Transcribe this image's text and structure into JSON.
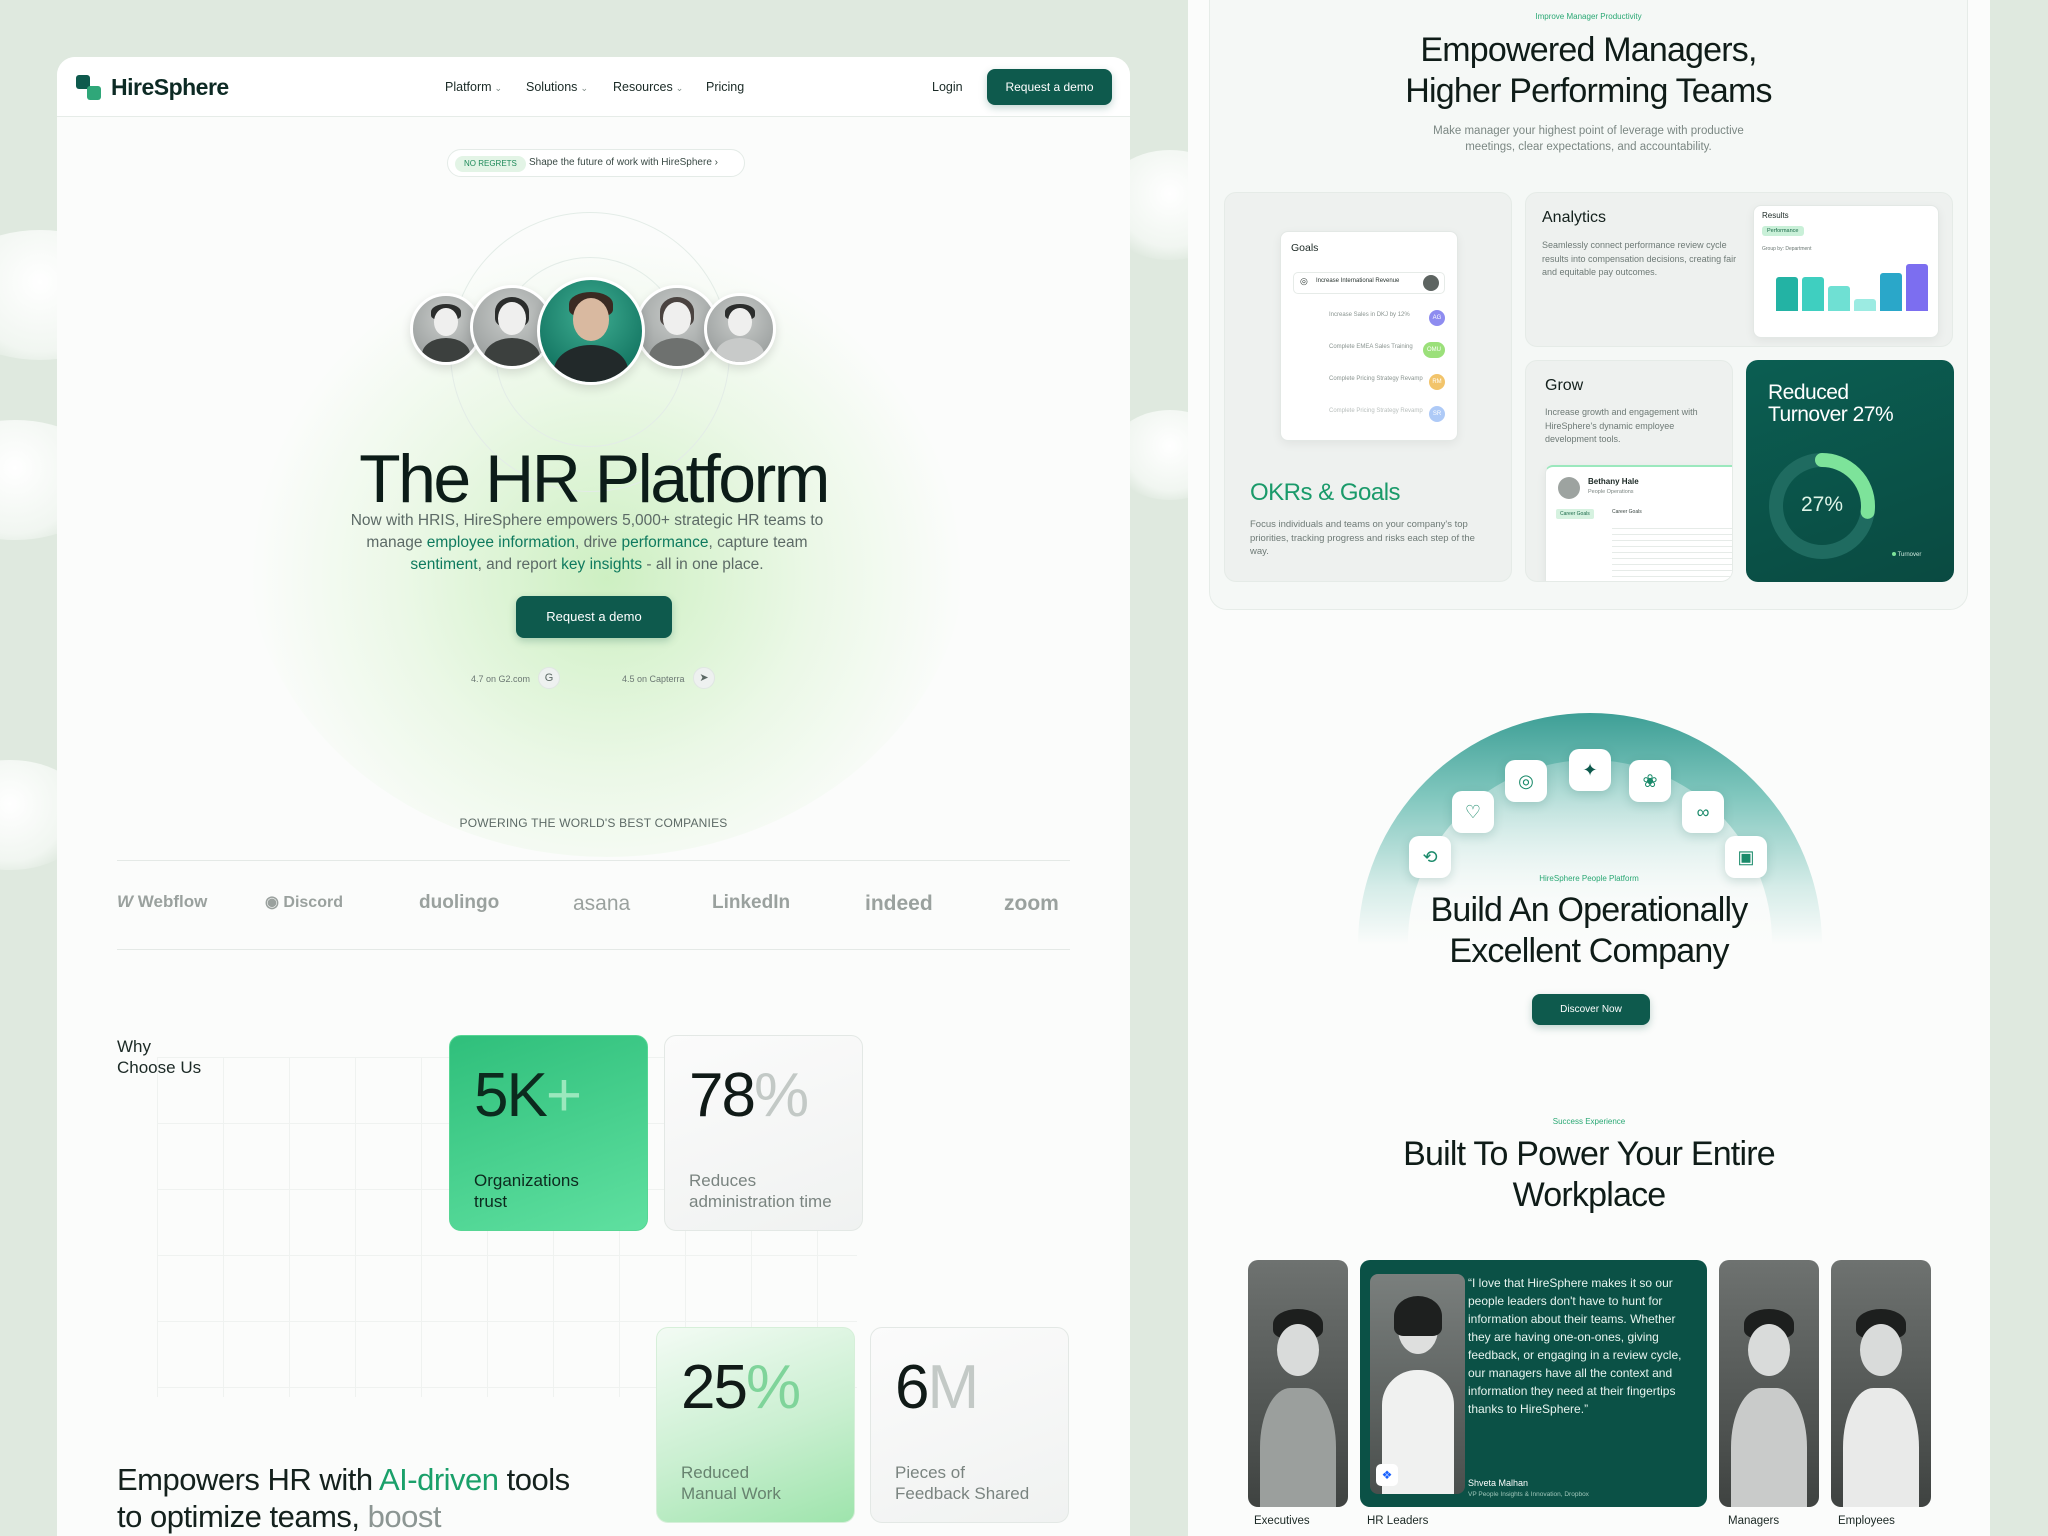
{
  "left": {
    "nav": {
      "logo": "HireSphere",
      "items": [
        {
          "label": "Platform",
          "has_dropdown": true
        },
        {
          "label": "Solutions",
          "has_dropdown": true
        },
        {
          "label": "Resources",
          "has_dropdown": true
        },
        {
          "label": "Pricing",
          "has_dropdown": false
        }
      ],
      "login": "Login",
      "cta": "Request a demo"
    },
    "banner": {
      "tag": "NO REGRETS",
      "text": "Shape the future of work with HireSphere",
      "arrow": "›"
    },
    "hero": {
      "title": "The HR Platform",
      "subtitle_parts": [
        "Now with HRIS, HireSphere empowers 5,000+ strategic HR teams to manage ",
        "employee information",
        ", drive ",
        "performance",
        ", capture team ",
        "sentiment",
        ", and report ",
        "key insights",
        " - all in one place."
      ],
      "cta": "Request a demo"
    },
    "ratings": [
      {
        "label": "4.7 on G2.com",
        "icon": "g2-icon"
      },
      {
        "label": "4.5 on Capterra",
        "icon": "capterra-icon"
      }
    ],
    "powering": "POWERING THE WORLD'S BEST COMPANIES",
    "brands": [
      "Webflow",
      "Discord",
      "duolingo",
      "asana",
      "LinkedIn",
      "indeed",
      "zoom"
    ],
    "why": {
      "line1": "Why",
      "line2": "Choose Us"
    },
    "stats": [
      {
        "main": "5K",
        "suffix": "+",
        "line1": "Organizations",
        "line2": "trust"
      },
      {
        "main": "78",
        "suffix": "%",
        "line1": "Reduces",
        "line2": "administration time"
      },
      {
        "main": "25",
        "suffix": "%",
        "line1": "Reduced",
        "line2": "Manual Work"
      },
      {
        "main": "6",
        "suffix": "M",
        "line1": "Pieces of",
        "line2": "Feedback Shared"
      }
    ],
    "empower": {
      "p1": "Empowers HR with ",
      "ai": "AI-driven",
      "p2": " tools to optimize teams, ",
      "muted": "boost productivity, and drive success"
    }
  },
  "right": {
    "managers": {
      "eyebrow": "Improve Manager Productivity",
      "title_line1": "Empowered Managers,",
      "title_line2": "Higher Performing Teams",
      "sub_line1": "Make manager your highest point of leverage with productive",
      "sub_line2": "meetings, clear expectations, and accountability."
    },
    "okr": {
      "goals_label": "Goals",
      "goals": [
        {
          "text": "Increase International Revenue",
          "badge": ""
        },
        {
          "text": "Increase Sales in DKJ by 12%",
          "badge": "AG"
        },
        {
          "text": "Complete EMEA Sales Training",
          "badge": "OMU"
        },
        {
          "text": "Complete Pricing Strategy Revamp",
          "badge": "RM"
        },
        {
          "text": "Complete Pricing Strategy Revamp",
          "badge": "SR"
        }
      ],
      "title": "OKRs & Goals",
      "desc": "Focus individuals and teams on your company's top priorities, tracking progress and risks each step of the way."
    },
    "analytics": {
      "title": "Analytics",
      "desc": "Seamlessly connect performance review cycle results into compensation decisions, creating fair and equitable pay outcomes.",
      "results_label": "Results",
      "results_pill": "Performance",
      "results_filter": "Group by: Department",
      "bars": [
        0.55,
        0.55,
        0.4,
        0.2,
        0.62,
        0.75
      ]
    },
    "grow": {
      "title": "Grow",
      "desc": "Increase growth and engagement with HireSphere's dynamic employee development tools.",
      "person_name": "Bethany Hale",
      "person_role": "People Operations",
      "tab1": "Career Goals",
      "tab2": "Career Goals"
    },
    "turnover": {
      "title_line1": "Reduced",
      "title_line2": "Turnover 27%",
      "percent": "27%",
      "value": 0.27,
      "legend": "Turnover"
    },
    "operational": {
      "eyebrow": "HireSphere People Platform",
      "title_line1": "Build An Operationally",
      "title_line2": "Excellent Company",
      "cta": "Discover Now"
    },
    "workplace": {
      "eyebrow": "Success Experience",
      "title_line1": "Built To Power Your Entire",
      "title_line2": "Workplace",
      "quote": "“I love that HireSphere makes it so our people leaders don't have to hunt for information about their teams. Whether they are having one-on-ones, giving feedback, or engaging in a review cycle, our managers have all the context and information they need at their fingertips thanks to HireSphere.”",
      "quote_name": "Shveta Malhan",
      "quote_role": "VP People Insights & Innovation, Dropbox",
      "labels": [
        "Executives",
        "HR Leaders",
        "Managers",
        "Employees"
      ]
    }
  },
  "colors": {
    "brand_dark": "#0e5a4d",
    "brand_green": "#1aa06a",
    "page_bg": "#dfe9df"
  }
}
